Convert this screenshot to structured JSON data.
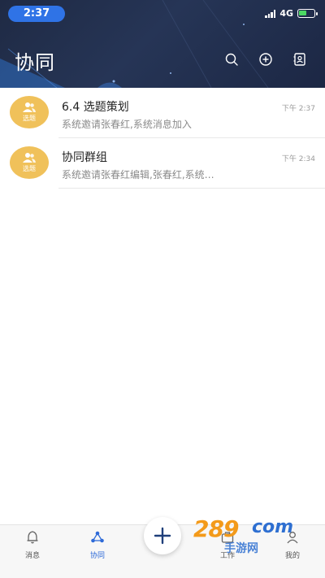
{
  "status_bar": {
    "time": "2:37",
    "network": "4G"
  },
  "header": {
    "title": "协同",
    "icons": [
      "search-icon",
      "add-circle-icon",
      "contacts-icon"
    ]
  },
  "conversations": [
    {
      "avatar_label": "选题",
      "title": "6.4 选题策划",
      "subtitle": "系统邀请张春红,系统消息加入",
      "time": "下午 2:37"
    },
    {
      "avatar_label": "选题",
      "title": "协同群组",
      "subtitle": "系统邀请张春红编辑,张春红,系统…",
      "time": "下午 2:34"
    }
  ],
  "tabbar": {
    "tabs": [
      {
        "label": "消息",
        "icon": "bell-icon"
      },
      {
        "label": "协同",
        "icon": "collaboration-icon",
        "active": true
      },
      {
        "label": "工作",
        "icon": "work-icon"
      },
      {
        "label": "我的",
        "icon": "profile-icon"
      }
    ],
    "fab_icon": "plus-icon"
  },
  "watermark": {
    "number": "289",
    "domain": "com",
    "text": "手游网"
  },
  "colors": {
    "header_bg": "#1f2a44",
    "accent": "#2f6bd8",
    "avatar": "#f0c15a",
    "time_pill": "#2f73e6"
  }
}
